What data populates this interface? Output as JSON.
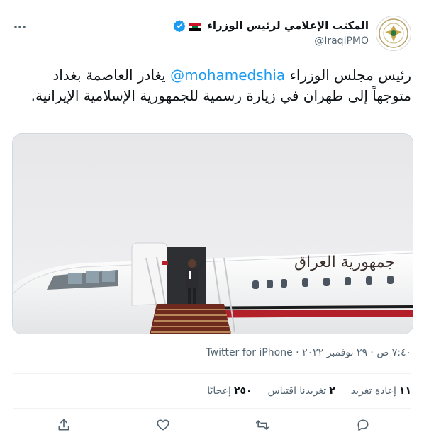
{
  "account": {
    "display_name": "المكتب الإعلامي لرئيس الوزراء",
    "handle": "@IraqiPMO",
    "verified": true,
    "flag_icon": "iraq-flag-icon"
  },
  "more_icon": "more-options-icon",
  "tweet": {
    "text_before_mention": "رئيس مجلس الوزراء ",
    "mention": "@mohamedshia",
    "text_after_mention": " يغادر العاصمة بغداد متوجهاً إلى طهران في زيارة رسمية للجمهورية الإسلامية الإيرانية."
  },
  "media": {
    "fuselage_text": "جمهورية العراق"
  },
  "meta_line": "٧:٤٠ ص · ٢٩ نوفمبر ٢٠٢٢ · Twitter for iPhone",
  "stats": {
    "retweets_count": "١١",
    "retweets_label": "إعادة تغريد",
    "quotes_count": "٢",
    "quotes_label": "تغريدنا اقتباس",
    "likes_count": "٢٥٠",
    "likes_label": "إعجابًا"
  },
  "actions": {
    "reply_icon": "reply-icon",
    "retweet_icon": "retweet-icon",
    "like_icon": "heart-icon",
    "share_icon": "share-icon"
  },
  "colors": {
    "accent": "#1d9bf0",
    "text": "#0f1419",
    "secondary": "#536471",
    "aircraft_stripe": "#b3202a"
  }
}
